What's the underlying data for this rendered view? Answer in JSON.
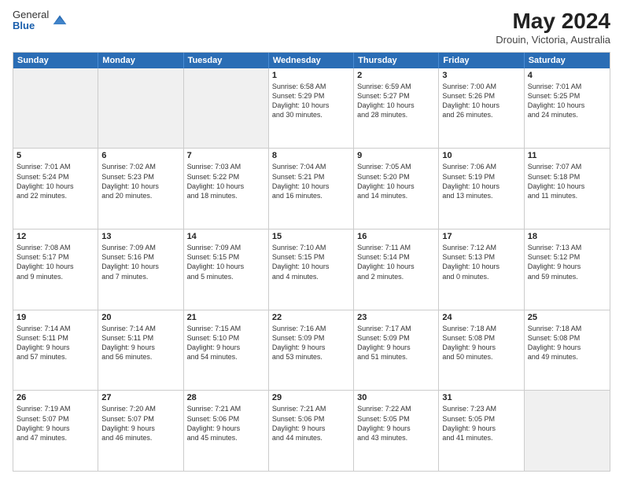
{
  "logo": {
    "general": "General",
    "blue": "Blue"
  },
  "title": "May 2024",
  "location": "Drouin, Victoria, Australia",
  "headers": [
    "Sunday",
    "Monday",
    "Tuesday",
    "Wednesday",
    "Thursday",
    "Friday",
    "Saturday"
  ],
  "rows": [
    [
      {
        "day": "",
        "info": ""
      },
      {
        "day": "",
        "info": ""
      },
      {
        "day": "",
        "info": ""
      },
      {
        "day": "1",
        "info": "Sunrise: 6:58 AM\nSunset: 5:29 PM\nDaylight: 10 hours\nand 30 minutes."
      },
      {
        "day": "2",
        "info": "Sunrise: 6:59 AM\nSunset: 5:27 PM\nDaylight: 10 hours\nand 28 minutes."
      },
      {
        "day": "3",
        "info": "Sunrise: 7:00 AM\nSunset: 5:26 PM\nDaylight: 10 hours\nand 26 minutes."
      },
      {
        "day": "4",
        "info": "Sunrise: 7:01 AM\nSunset: 5:25 PM\nDaylight: 10 hours\nand 24 minutes."
      }
    ],
    [
      {
        "day": "5",
        "info": "Sunrise: 7:01 AM\nSunset: 5:24 PM\nDaylight: 10 hours\nand 22 minutes."
      },
      {
        "day": "6",
        "info": "Sunrise: 7:02 AM\nSunset: 5:23 PM\nDaylight: 10 hours\nand 20 minutes."
      },
      {
        "day": "7",
        "info": "Sunrise: 7:03 AM\nSunset: 5:22 PM\nDaylight: 10 hours\nand 18 minutes."
      },
      {
        "day": "8",
        "info": "Sunrise: 7:04 AM\nSunset: 5:21 PM\nDaylight: 10 hours\nand 16 minutes."
      },
      {
        "day": "9",
        "info": "Sunrise: 7:05 AM\nSunset: 5:20 PM\nDaylight: 10 hours\nand 14 minutes."
      },
      {
        "day": "10",
        "info": "Sunrise: 7:06 AM\nSunset: 5:19 PM\nDaylight: 10 hours\nand 13 minutes."
      },
      {
        "day": "11",
        "info": "Sunrise: 7:07 AM\nSunset: 5:18 PM\nDaylight: 10 hours\nand 11 minutes."
      }
    ],
    [
      {
        "day": "12",
        "info": "Sunrise: 7:08 AM\nSunset: 5:17 PM\nDaylight: 10 hours\nand 9 minutes."
      },
      {
        "day": "13",
        "info": "Sunrise: 7:09 AM\nSunset: 5:16 PM\nDaylight: 10 hours\nand 7 minutes."
      },
      {
        "day": "14",
        "info": "Sunrise: 7:09 AM\nSunset: 5:15 PM\nDaylight: 10 hours\nand 5 minutes."
      },
      {
        "day": "15",
        "info": "Sunrise: 7:10 AM\nSunset: 5:15 PM\nDaylight: 10 hours\nand 4 minutes."
      },
      {
        "day": "16",
        "info": "Sunrise: 7:11 AM\nSunset: 5:14 PM\nDaylight: 10 hours\nand 2 minutes."
      },
      {
        "day": "17",
        "info": "Sunrise: 7:12 AM\nSunset: 5:13 PM\nDaylight: 10 hours\nand 0 minutes."
      },
      {
        "day": "18",
        "info": "Sunrise: 7:13 AM\nSunset: 5:12 PM\nDaylight: 9 hours\nand 59 minutes."
      }
    ],
    [
      {
        "day": "19",
        "info": "Sunrise: 7:14 AM\nSunset: 5:11 PM\nDaylight: 9 hours\nand 57 minutes."
      },
      {
        "day": "20",
        "info": "Sunrise: 7:14 AM\nSunset: 5:11 PM\nDaylight: 9 hours\nand 56 minutes."
      },
      {
        "day": "21",
        "info": "Sunrise: 7:15 AM\nSunset: 5:10 PM\nDaylight: 9 hours\nand 54 minutes."
      },
      {
        "day": "22",
        "info": "Sunrise: 7:16 AM\nSunset: 5:09 PM\nDaylight: 9 hours\nand 53 minutes."
      },
      {
        "day": "23",
        "info": "Sunrise: 7:17 AM\nSunset: 5:09 PM\nDaylight: 9 hours\nand 51 minutes."
      },
      {
        "day": "24",
        "info": "Sunrise: 7:18 AM\nSunset: 5:08 PM\nDaylight: 9 hours\nand 50 minutes."
      },
      {
        "day": "25",
        "info": "Sunrise: 7:18 AM\nSunset: 5:08 PM\nDaylight: 9 hours\nand 49 minutes."
      }
    ],
    [
      {
        "day": "26",
        "info": "Sunrise: 7:19 AM\nSunset: 5:07 PM\nDaylight: 9 hours\nand 47 minutes."
      },
      {
        "day": "27",
        "info": "Sunrise: 7:20 AM\nSunset: 5:07 PM\nDaylight: 9 hours\nand 46 minutes."
      },
      {
        "day": "28",
        "info": "Sunrise: 7:21 AM\nSunset: 5:06 PM\nDaylight: 9 hours\nand 45 minutes."
      },
      {
        "day": "29",
        "info": "Sunrise: 7:21 AM\nSunset: 5:06 PM\nDaylight: 9 hours\nand 44 minutes."
      },
      {
        "day": "30",
        "info": "Sunrise: 7:22 AM\nSunset: 5:05 PM\nDaylight: 9 hours\nand 43 minutes."
      },
      {
        "day": "31",
        "info": "Sunrise: 7:23 AM\nSunset: 5:05 PM\nDaylight: 9 hours\nand 41 minutes."
      },
      {
        "day": "",
        "info": ""
      }
    ]
  ]
}
